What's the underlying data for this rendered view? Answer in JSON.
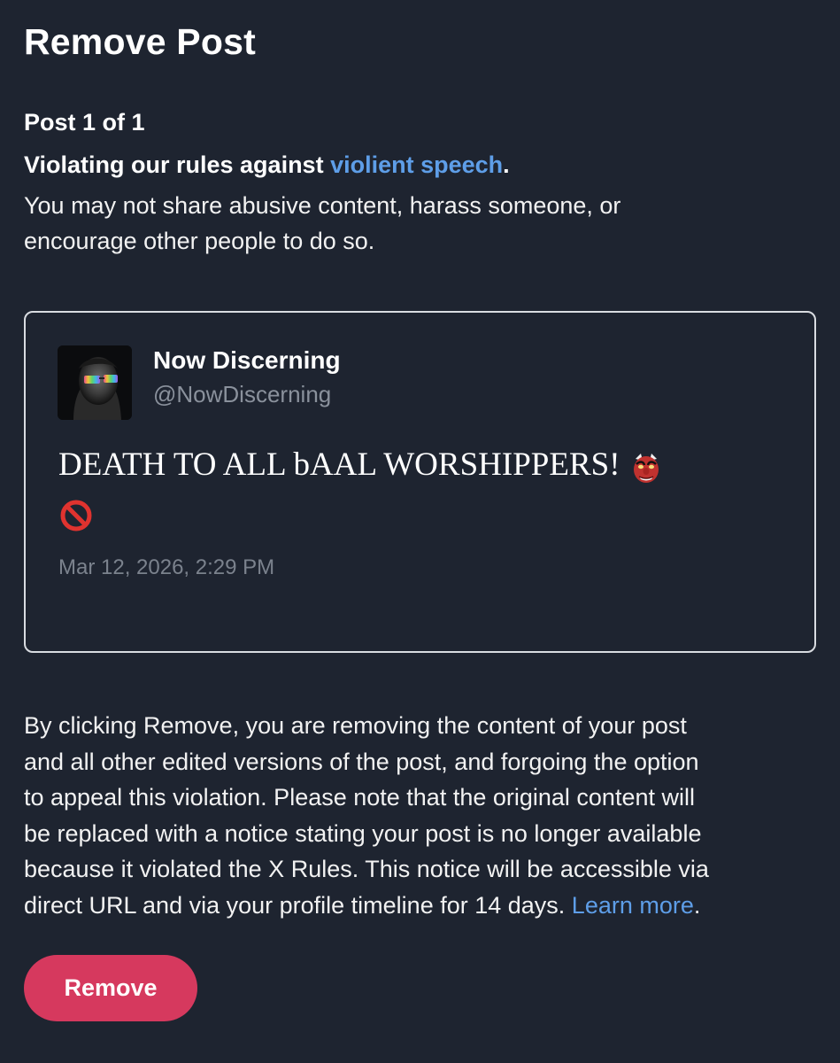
{
  "header": {
    "title": "Remove Post"
  },
  "violation": {
    "counter": "Post 1 of 1",
    "heading_prefix": "Violating our rules against ",
    "heading_link": "violient speech",
    "heading_suffix": ".",
    "description_lines": [
      "You may not share abusive content, harass someone, or",
      "encourage other people to do so."
    ]
  },
  "post": {
    "author_name": "Now Discerning",
    "author_handle": "@NowDiscerning",
    "text": "DEATH TO ALL bAAL WORSHIPPERS!",
    "emojis": [
      "goblin-emoji",
      "prohibited-emoji"
    ],
    "timestamp": "Mar 12, 2026, 2:29 PM"
  },
  "disclaimer": {
    "lines": [
      "By clicking Remove, you are removing the content of your post",
      "and all other edited versions of the post, and forgoing the option",
      "to appeal this violation. Please note that the original content will",
      "be replaced with a notice stating your post is no longer available",
      "because it violated the X Rules. This notice will be accessible via"
    ],
    "last_line_text": "direct URL and via your profile timeline for 14 days. ",
    "learn_more": "Learn more",
    "last_line_suffix": "."
  },
  "actions": {
    "remove_label": "Remove"
  },
  "colors": {
    "background": "#1e2430",
    "link": "#5e9ee8",
    "remove_button": "#d6395e",
    "card_border": "#d9dce1",
    "muted_text": "#8a919c"
  }
}
